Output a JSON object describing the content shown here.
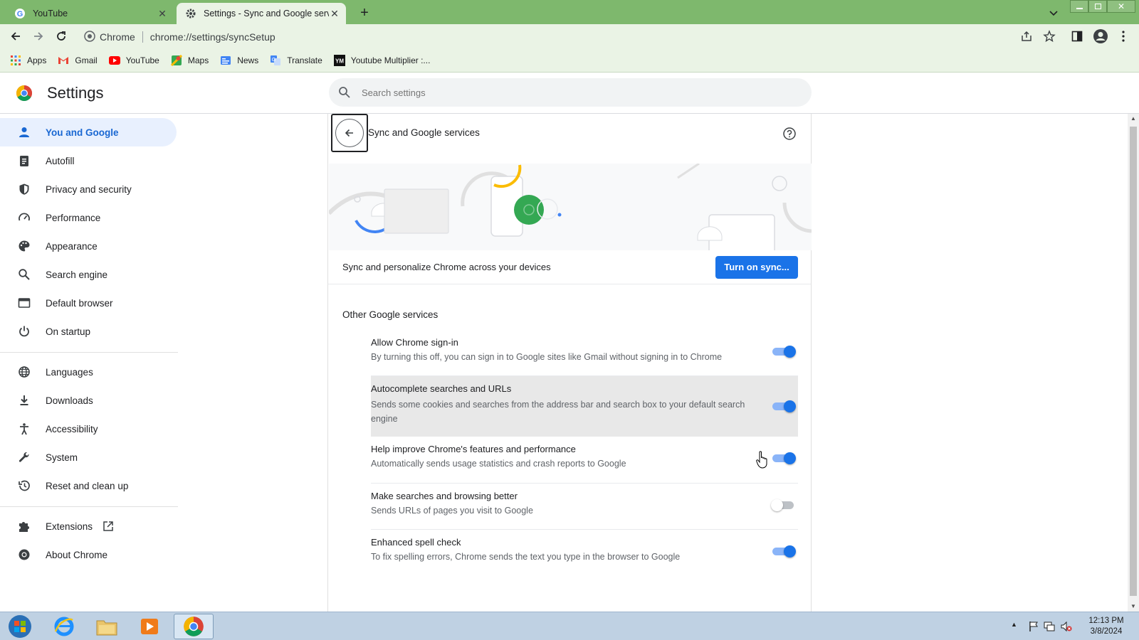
{
  "tabs": [
    {
      "title": "YouTube",
      "active": false
    },
    {
      "title": "Settings - Sync and Google servi",
      "active": true
    }
  ],
  "omnibox": {
    "site_label": "Chrome",
    "url": "chrome://settings/syncSetup"
  },
  "bookmarks": [
    {
      "label": "Apps",
      "icon": "apps-grid-icon"
    },
    {
      "label": "Gmail",
      "icon": "gmail-icon"
    },
    {
      "label": "YouTube",
      "icon": "youtube-icon"
    },
    {
      "label": "Maps",
      "icon": "maps-icon"
    },
    {
      "label": "News",
      "icon": "news-icon"
    },
    {
      "label": "Translate",
      "icon": "translate-icon"
    },
    {
      "label": "Youtube Multiplier :...",
      "icon": "ym-icon"
    }
  ],
  "header": {
    "title": "Settings",
    "search_placeholder": "Search settings"
  },
  "sidebar": {
    "items": [
      {
        "label": "You and Google",
        "icon": "person-icon"
      },
      {
        "label": "Autofill",
        "icon": "clipboard-icon"
      },
      {
        "label": "Privacy and security",
        "icon": "shield-icon"
      },
      {
        "label": "Performance",
        "icon": "speedometer-icon"
      },
      {
        "label": "Appearance",
        "icon": "palette-icon"
      },
      {
        "label": "Search engine",
        "icon": "search-icon"
      },
      {
        "label": "Default browser",
        "icon": "browser-window-icon"
      },
      {
        "label": "On startup",
        "icon": "power-icon"
      },
      {
        "label": "Languages",
        "icon": "globe-icon"
      },
      {
        "label": "Downloads",
        "icon": "download-icon"
      },
      {
        "label": "Accessibility",
        "icon": "accessibility-icon"
      },
      {
        "label": "System",
        "icon": "wrench-icon"
      },
      {
        "label": "Reset and clean up",
        "icon": "history-icon"
      },
      {
        "label": "Extensions",
        "icon": "puzzle-icon"
      },
      {
        "label": "About Chrome",
        "icon": "chrome-icon"
      }
    ]
  },
  "main": {
    "heading": "Sync and Google services",
    "sync_text": "Sync and personalize Chrome across your devices",
    "sync_button": "Turn on sync...",
    "section_title": "Other Google services",
    "services": [
      {
        "title": "Allow Chrome sign-in",
        "desc": "By turning this off, you can sign in to Google sites like Gmail without signing in to Chrome",
        "enabled": true
      },
      {
        "title": "Autocomplete searches and URLs",
        "desc": "Sends some cookies and searches from the address bar and search box to your default search engine",
        "enabled": true
      },
      {
        "title": "Help improve Chrome's features and performance",
        "desc": "Automatically sends usage statistics and crash reports to Google",
        "enabled": true
      },
      {
        "title": "Make searches and browsing better",
        "desc": "Sends URLs of pages you visit to Google",
        "enabled": false
      },
      {
        "title": "Enhanced spell check",
        "desc": "To fix spelling errors, Chrome sends the text you type in the browser to Google",
        "enabled": true
      }
    ]
  },
  "taskbar": {
    "time": "12:13 PM",
    "date": "3/8/2024"
  },
  "colors": {
    "titlebar": "#7eb86d",
    "toolbar": "#eaf3e5",
    "accent": "#1a73e8",
    "selected_nav": "#e8f0fe"
  }
}
